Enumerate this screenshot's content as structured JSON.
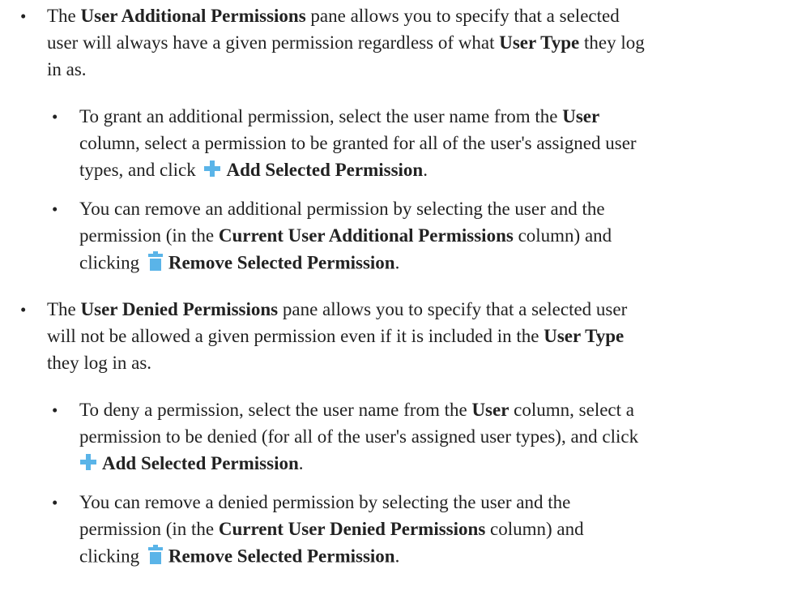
{
  "sections": [
    {
      "intro": {
        "part1": "The ",
        "term1": "User Additional Permissions",
        "part2": " pane allows you to specify that a selected",
        "part3": "user will always have a given permission regardless of what ",
        "term2": "User Type",
        "part4": " they log",
        "part5": "in as."
      },
      "sub": [
        {
          "part1": "To grant an additional permission, select the user name from the ",
          "term1": "User",
          "part2": "column, select a permission to be granted for all of the user's assigned user",
          "part3": "types, and click ",
          "icon": "plus-icon",
          "action": "Add Selected Permission",
          "end": "."
        },
        {
          "part1": "You can remove an additional permission by selecting the user and the",
          "part2": "permission (in the ",
          "term1": "Current User Additional Permissions",
          "part3": " column) and",
          "part4": "clicking ",
          "icon": "trash-icon",
          "action": "Remove Selected Permission",
          "end": "."
        }
      ]
    },
    {
      "intro": {
        "part1": "The ",
        "term1": "User Denied Permissions",
        "part2": " pane allows you to specify that a selected user",
        "part3": "will not be allowed a given permission even if it is included in the ",
        "term2": "User Type",
        "part5": "they log in as."
      },
      "sub": [
        {
          "part1": "To deny a permission, select the user name from the ",
          "term1": "User",
          "part2": " column, select a",
          "part3": "permission to be denied (for all of the user's assigned user types), and click",
          "icon": "plus-icon",
          "action": "Add Selected Permission",
          "end": "."
        },
        {
          "part1": "You can remove a denied permission by selecting the user and the",
          "part2": "permission (in the ",
          "term1": "Current User Denied Permissions",
          "part3": " column) and",
          "part4": "clicking ",
          "icon": "trash-icon",
          "action": "Remove Selected Permission",
          "end": "."
        }
      ]
    }
  ],
  "bullet_char": "•",
  "colors": {
    "text": "#222222",
    "plus_icon": "#5ab4e8",
    "trash_icon": "#5ab4e8"
  }
}
